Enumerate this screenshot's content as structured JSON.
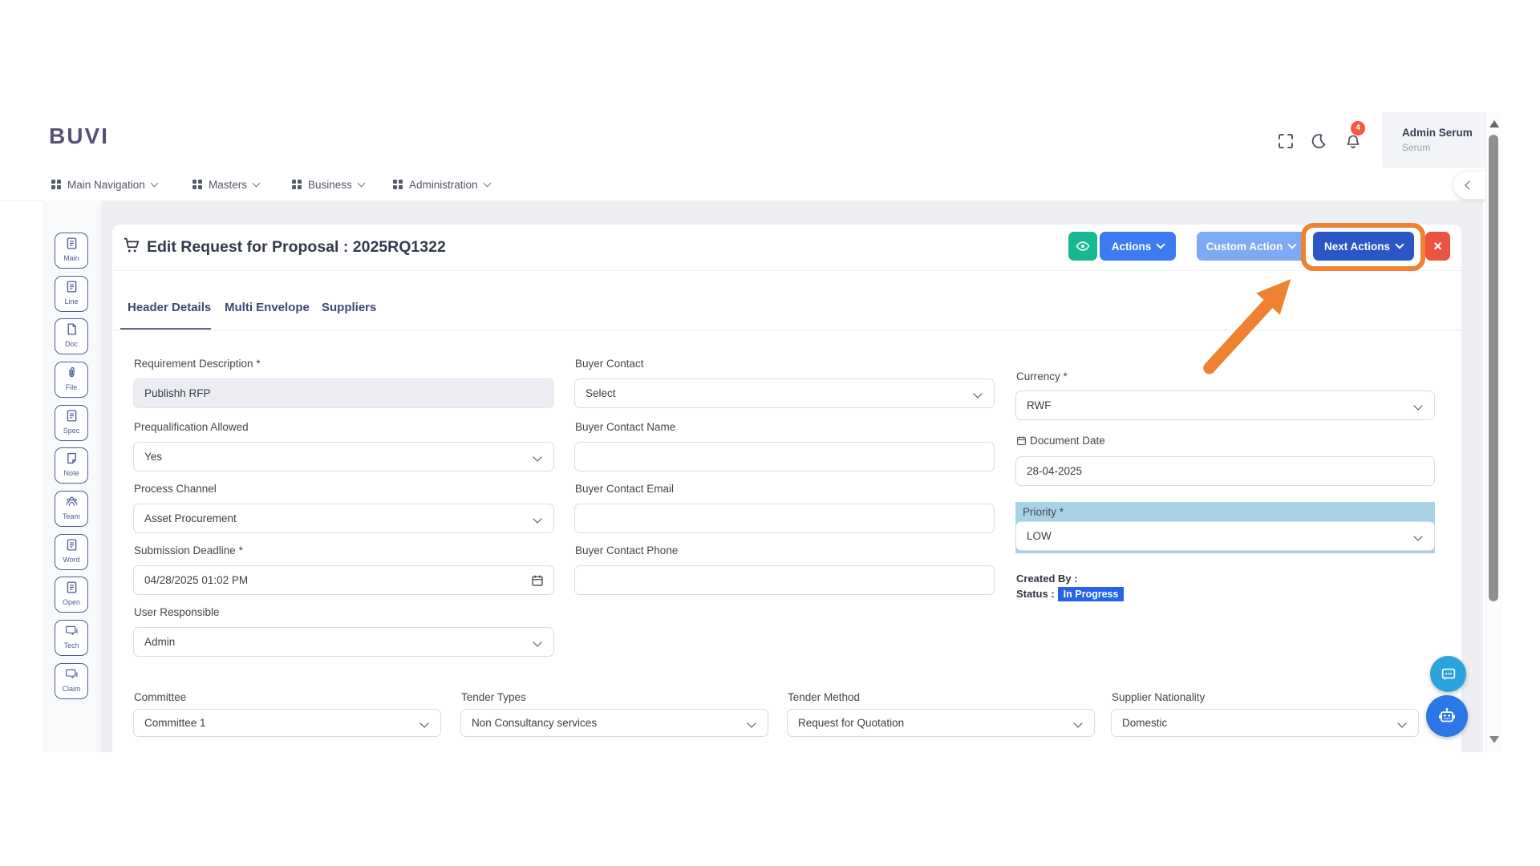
{
  "brand": {
    "logo": "BUVI"
  },
  "header": {
    "notification_count": "4",
    "user": {
      "name": "Admin Serum",
      "org": "Serum"
    },
    "icons": [
      "fullscreen-icon",
      "dark-mode-moon-icon",
      "notification-bell-icon"
    ]
  },
  "nav": {
    "items": [
      {
        "label": "Main Navigation"
      },
      {
        "label": "Masters"
      },
      {
        "label": "Business"
      },
      {
        "label": "Administration"
      }
    ]
  },
  "sidebar": {
    "items": [
      {
        "label": "Main",
        "icon": "doc-lines-icon"
      },
      {
        "label": "Line",
        "icon": "doc-lines-icon"
      },
      {
        "label": "Doc",
        "icon": "page-icon"
      },
      {
        "label": "File",
        "icon": "paperclip-icon"
      },
      {
        "label": "Spec",
        "icon": "doc-lines-icon"
      },
      {
        "label": "Note",
        "icon": "note-icon"
      },
      {
        "label": "Team",
        "icon": "team-icon"
      },
      {
        "label": "Word",
        "icon": "doc-lines-icon"
      },
      {
        "label": "Open",
        "icon": "doc-lines-icon"
      },
      {
        "label": "Tech",
        "icon": "chat-icon"
      },
      {
        "label": "Claim",
        "icon": "chat-icon"
      }
    ]
  },
  "page": {
    "title": "Edit Request for Proposal : 2025RQ1322",
    "buttons": {
      "actions": "Actions",
      "custom_action": "Custom Action",
      "next_actions": "Next Actions",
      "close": "×"
    },
    "tabs": [
      {
        "label": "Header Details",
        "active": true
      },
      {
        "label": "Multi Envelope",
        "active": false
      },
      {
        "label": "Suppliers",
        "active": false
      }
    ]
  },
  "form": {
    "requirement_description": {
      "label": "Requirement Description *",
      "value": "Publishh RFP"
    },
    "prequalification_allowed": {
      "label": "Prequalification Allowed",
      "value": "Yes"
    },
    "process_channel": {
      "label": "Process Channel",
      "value": "Asset Procurement"
    },
    "submission_deadline": {
      "label": "Submission Deadline *",
      "value": "04/28/2025 01:02 PM"
    },
    "user_responsible": {
      "label": "User Responsible",
      "value": "Admin"
    },
    "buyer_contact": {
      "label": "Buyer Contact",
      "value": "Select"
    },
    "buyer_contact_name": {
      "label": "Buyer Contact Name",
      "value": ""
    },
    "buyer_contact_email": {
      "label": "Buyer Contact Email",
      "value": ""
    },
    "buyer_contact_phone": {
      "label": "Buyer Contact Phone",
      "value": ""
    },
    "currency": {
      "label": "Currency *",
      "value": "RWF"
    },
    "document_date": {
      "label": "Document Date",
      "value": "28-04-2025"
    },
    "priority": {
      "label": "Priority *",
      "value": "LOW"
    },
    "created_by": {
      "label": "Created By :",
      "value": ""
    },
    "status": {
      "label": "Status :",
      "value": "In Progress"
    },
    "committee": {
      "label": "Committee",
      "value": "Committee 1"
    },
    "tender_types": {
      "label": "Tender Types",
      "value": "Non Consultancy services"
    },
    "tender_method": {
      "label": "Tender Method",
      "value": "Request for Quotation"
    },
    "supplier_nationality": {
      "label": "Supplier Nationality",
      "value": "Domestic"
    }
  },
  "colors": {
    "eye_button": "#17b793",
    "actions_button": "#3d7bf0",
    "custom_action_button": "#7ea9f3",
    "next_actions_button": "#2a56c6",
    "close_button": "#eb5440",
    "annotation_orange": "#ee8132",
    "priority_highlight": "#a8d3e6",
    "status_badge": "#2563eb",
    "notification_badge": "#f4593b"
  }
}
